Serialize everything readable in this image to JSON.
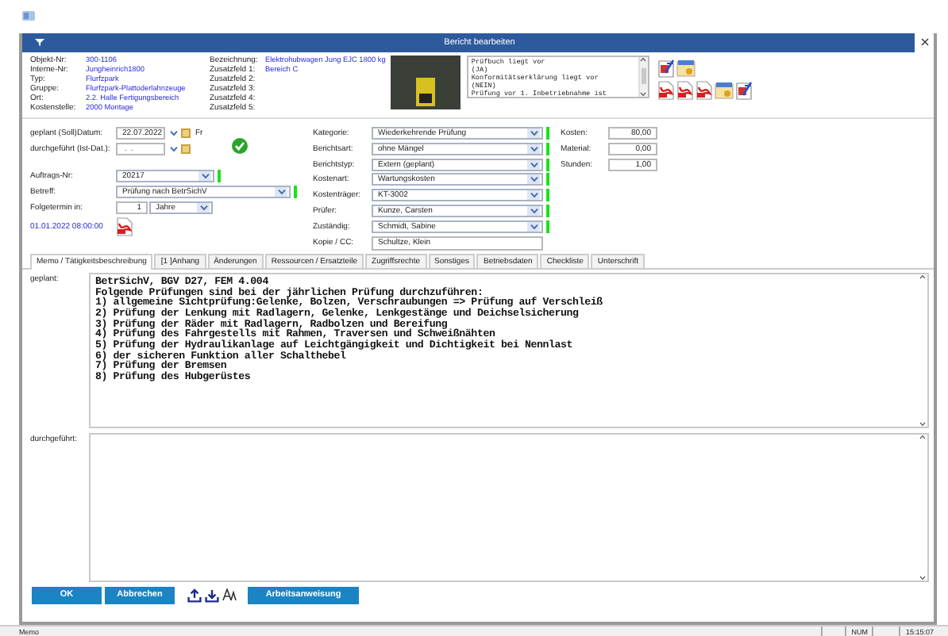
{
  "window": {
    "title": "Bericht bearbeiten"
  },
  "header": {
    "left": [
      {
        "label": "Objekt-Nr:",
        "value": "300-1106"
      },
      {
        "label": "Interne-Nr:",
        "value": "Jungheinrich1800"
      },
      {
        "label": "Typ:",
        "value": "Flurfzpark"
      },
      {
        "label": "Gruppe:",
        "value": "Flurfzpark-Plattoderlahnzeuge"
      },
      {
        "label": "Ort:",
        "value": "2.2. Halle Fertigungsbereich"
      },
      {
        "label": "Kostenstelle:",
        "value": "2000 Montage"
      }
    ],
    "right": [
      {
        "label": "Bezeichnung:",
        "value": "Elektrohubwagen Jung EJC 1800 kg"
      },
      {
        "label": "Zusatzfeld 1:",
        "value": "Bereich C"
      },
      {
        "label": "Zusatzfeld 2:"
      },
      {
        "label": "Zusatzfeld 3:"
      },
      {
        "label": "Zusatzfeld 4:"
      },
      {
        "label": "Zusatzfeld 5:"
      }
    ],
    "notes": [
      "Prüfbuch liegt vor",
      "(JA)",
      "Konformitätserklärung liegt vor",
      "(NEIN)",
      "Prüfung vor 1. Inbetriebnahme ist"
    ]
  },
  "form": {
    "planned": {
      "label": "geplant (Soll)Datum:",
      "value": "22.07.2022",
      "weekday": "Fr"
    },
    "done": {
      "label": "durchgeführt (Ist-Dat.):",
      "value": " .  . "
    },
    "left": [
      {
        "label": "Auftrags-Nr:",
        "value": "20217",
        "marked": true
      },
      {
        "label": "Betreff:",
        "value": "Prüfung nach BetrSichV",
        "marked": true
      }
    ],
    "followup": {
      "label": "Folgetermin in:",
      "count": "1",
      "unit": "Jahre"
    },
    "timestamp": "01.01.2022 08:00:00",
    "middle": [
      {
        "label": "Kategorie:",
        "value": "Wiederkehrende Prüfung",
        "marked": true
      },
      {
        "label": "Berichtsart:",
        "value": "ohne Mängel",
        "marked": true
      },
      {
        "label": "Berichtstyp:",
        "value": "Extern (geplant)",
        "marked": true
      },
      {
        "label": "Kostenart:",
        "value": "Wartungskosten",
        "marked": true
      },
      {
        "label": "Kostenträger:",
        "value": "KT-3002",
        "marked": true
      },
      {
        "label": "Prüfer:",
        "value": "Kunze, Carsten",
        "marked": true
      },
      {
        "label": "Zuständig:",
        "value": "Schmidt, Sabine",
        "marked": true
      }
    ],
    "copy": {
      "label": "Kopie / CC:",
      "value": "Schultze, Klein"
    },
    "costs": [
      {
        "label": "Kosten:",
        "value": "80,00"
      },
      {
        "label": "Material:",
        "value": "0,00"
      },
      {
        "label": "Stunden:",
        "value": "1,00"
      }
    ]
  },
  "tabs": [
    {
      "label": "Memo / Tätigkeitsbeschreibung",
      "selected": true
    },
    {
      "label": "[1 ]Anhang",
      "selected": false
    },
    {
      "label": "Änderungen",
      "selected": false
    },
    {
      "label": "Ressourcen / Ersatzteile",
      "selected": false
    },
    {
      "label": "Zugriffsrechte",
      "selected": false
    },
    {
      "label": "Sonstiges",
      "selected": false
    },
    {
      "label": "Betriebsdaten",
      "selected": false
    },
    {
      "label": "Checkliste",
      "selected": false
    },
    {
      "label": "Unterschrift",
      "selected": false
    }
  ],
  "memo": {
    "planned_label": "geplant:",
    "planned_lines": [
      "BetrSichV, BGV D27, FEM 4.004",
      "Folgende Prüfungen sind bei der jährlichen Prüfung durchzuführen:",
      "1) allgemeine Sichtprüfung:Gelenke, Bolzen, Verschraubungen => Prüfung auf Verschleiß",
      "2) Prüfung der Lenkung mit Radlagern, Gelenke, Lenkgestänge und Deichselsicherung",
      "3) Prüfung der Räder mit Radlagern, Radbolzen und Bereifung",
      "4) Prüfung des Fahrgestells mit Rahmen, Traversen und Schweißnähten",
      "5) Prüfung der Hydraulikanlage auf Leichtgängigkeit und Dichtigkeit bei Nennlast",
      "6) der sicheren Funktion aller Schalthebel",
      "7) Prüfung der Bremsen",
      "8) Prüfung des Hubgerüstes"
    ],
    "done_label": "durchgeführt:"
  },
  "buttons": [
    {
      "label": "OK"
    },
    {
      "label": "Abbrechen"
    },
    {
      "label": "Arbeitsanweisung"
    }
  ],
  "status_bar": {
    "text": "Memo",
    "num": "NUM",
    "time": "15:15:07"
  }
}
